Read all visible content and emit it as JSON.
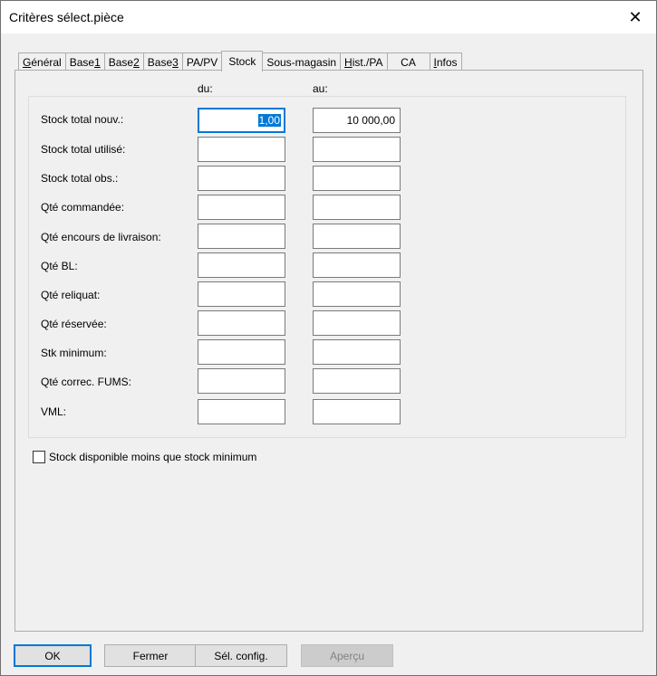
{
  "window": {
    "title": "Critères sélect.pièce",
    "close_glyph": "✕"
  },
  "tabs": [
    {
      "pre": "",
      "ul": "G",
      "post": "énéral"
    },
    {
      "pre": "Base ",
      "ul": "1",
      "post": ""
    },
    {
      "pre": "Base ",
      "ul": "2",
      "post": ""
    },
    {
      "pre": "Base ",
      "ul": "3",
      "post": ""
    },
    {
      "pre": "PA/PV",
      "ul": "",
      "post": ""
    },
    {
      "pre": "Stock",
      "ul": "",
      "post": ""
    },
    {
      "pre": "Sous-magasin",
      "ul": "",
      "post": ""
    },
    {
      "pre": "",
      "ul": "H",
      "post": "ist./PA"
    },
    {
      "pre": "CA",
      "ul": "",
      "post": ""
    },
    {
      "pre": "",
      "ul": "I",
      "post": "nfos"
    }
  ],
  "columns": {
    "from": "du:",
    "to": "au:"
  },
  "rows": [
    {
      "label": "Stock total nouv.:",
      "from": "1,00",
      "to": "10 000,00"
    },
    {
      "label": "Stock total utilisé:",
      "from": "",
      "to": ""
    },
    {
      "label": "Stock total obs.:",
      "from": "",
      "to": ""
    },
    {
      "label": "Qté commandée:",
      "from": "",
      "to": ""
    },
    {
      "label": "Qté encours de livraison:",
      "from": "",
      "to": ""
    },
    {
      "label": "Qté BL:",
      "from": "",
      "to": ""
    },
    {
      "label": "Qté reliquat:",
      "from": "",
      "to": ""
    },
    {
      "label": "Qté réservée:",
      "from": "",
      "to": ""
    },
    {
      "label": "Stk minimum:",
      "from": "",
      "to": ""
    },
    {
      "label": "Qté correc. FUMS:",
      "from": "",
      "to": ""
    },
    {
      "label": "VML:",
      "from": "",
      "to": ""
    }
  ],
  "checkbox": {
    "label": "Stock disponible moins que stock minimum"
  },
  "buttons": {
    "ok": "OK",
    "close": "Fermer",
    "config": "Sél. config.",
    "preview": "Aperçu"
  }
}
